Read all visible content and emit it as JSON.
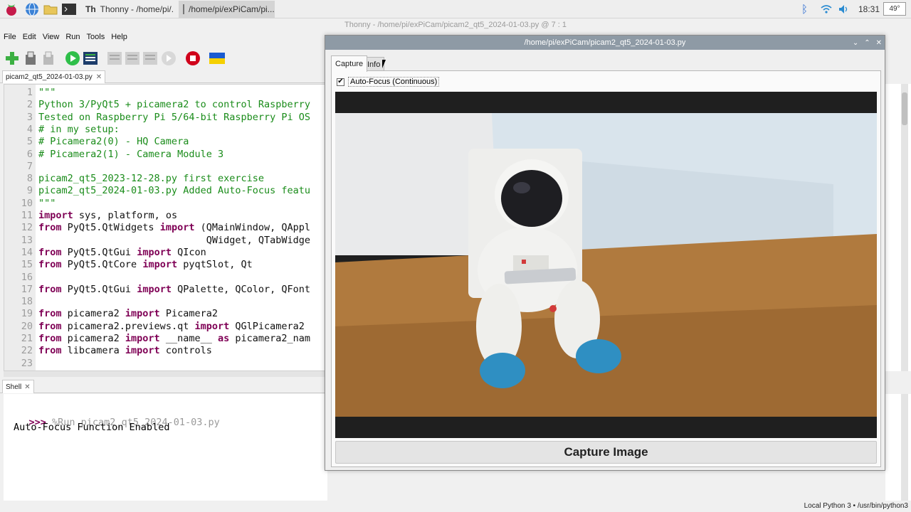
{
  "taskbar": {
    "tasks": [
      {
        "label": "Thonny  -  /home/pi/..."
      },
      {
        "label": "/home/pi/exPiCam/pi..."
      }
    ],
    "clock": "18:31",
    "cpu": "49°"
  },
  "thonny": {
    "title": "Thonny  -  /home/pi/exPiCam/picam2_qt5_2024-01-03.py  @  7 : 1",
    "menu": [
      "File",
      "Edit",
      "View",
      "Run",
      "Tools",
      "Help"
    ],
    "editor_tab": "picam2_qt5_2024-01-03.py",
    "line_numbers": [
      "1",
      "2",
      "3",
      "4",
      "5",
      "6",
      "7",
      "8",
      "9",
      "10",
      "11",
      "12",
      "13",
      "14",
      "15",
      "16",
      "17",
      "18",
      "19",
      "20",
      "21",
      "22",
      "23"
    ],
    "code_lines": [
      [
        {
          "t": "\"\"\"",
          "c": "str"
        }
      ],
      [
        {
          "t": "Python 3/PyQt5 + picamera2 to control Raspberry",
          "c": "str"
        }
      ],
      [
        {
          "t": "Tested on Raspberry Pi 5/64-bit Raspberry Pi OS",
          "c": "str"
        }
      ],
      [
        {
          "t": "# in my setup:",
          "c": "str"
        }
      ],
      [
        {
          "t": "# Picamera2(0) - HQ Camera",
          "c": "str"
        }
      ],
      [
        {
          "t": "# Picamera2(1) - Camera Module 3",
          "c": "str"
        }
      ],
      [
        {
          "t": "",
          "c": ""
        }
      ],
      [
        {
          "t": "picam2_qt5_2023-12-28.py first exercise",
          "c": "str"
        }
      ],
      [
        {
          "t": "picam2_qt5_2024-01-03.py Added Auto-Focus featu",
          "c": "str"
        }
      ],
      [
        {
          "t": "\"\"\"",
          "c": "str"
        }
      ],
      [
        {
          "t": "import",
          "c": "kw"
        },
        {
          "t": " sys, platform, os",
          "c": ""
        }
      ],
      [
        {
          "t": "from",
          "c": "kw"
        },
        {
          "t": " PyQt5.QtWidgets ",
          "c": ""
        },
        {
          "t": "import",
          "c": "kw"
        },
        {
          "t": " (QMainWindow, QAppl",
          "c": ""
        }
      ],
      [
        {
          "t": "                             QWidget, QTabWidge",
          "c": ""
        }
      ],
      [
        {
          "t": "from",
          "c": "kw"
        },
        {
          "t": " PyQt5.QtGui ",
          "c": ""
        },
        {
          "t": "import",
          "c": "kw"
        },
        {
          "t": " QIcon",
          "c": ""
        }
      ],
      [
        {
          "t": "from",
          "c": "kw"
        },
        {
          "t": " PyQt5.QtCore ",
          "c": ""
        },
        {
          "t": "import",
          "c": "kw"
        },
        {
          "t": " pyqtSlot, Qt",
          "c": ""
        }
      ],
      [
        {
          "t": "",
          "c": ""
        }
      ],
      [
        {
          "t": "from",
          "c": "kw"
        },
        {
          "t": " PyQt5.QtGui ",
          "c": ""
        },
        {
          "t": "import",
          "c": "kw"
        },
        {
          "t": " QPalette, QColor, QFont",
          "c": ""
        }
      ],
      [
        {
          "t": "",
          "c": ""
        }
      ],
      [
        {
          "t": "from",
          "c": "kw"
        },
        {
          "t": " picamera2 ",
          "c": ""
        },
        {
          "t": "import",
          "c": "kw"
        },
        {
          "t": " Picamera2",
          "c": ""
        }
      ],
      [
        {
          "t": "from",
          "c": "kw"
        },
        {
          "t": " picamera2.previews.qt ",
          "c": ""
        },
        {
          "t": "import",
          "c": "kw"
        },
        {
          "t": " QGlPicamera2",
          "c": ""
        }
      ],
      [
        {
          "t": "from",
          "c": "kw"
        },
        {
          "t": " picamera2 ",
          "c": ""
        },
        {
          "t": "import",
          "c": "kw"
        },
        {
          "t": " __name__ ",
          "c": ""
        },
        {
          "t": "as",
          "c": "kw"
        },
        {
          "t": " picamera2_nam",
          "c": ""
        }
      ],
      [
        {
          "t": "from",
          "c": "kw"
        },
        {
          "t": " libcamera ",
          "c": ""
        },
        {
          "t": "import",
          "c": "kw"
        },
        {
          "t": " controls",
          "c": ""
        }
      ],
      [
        {
          "t": "",
          "c": ""
        }
      ]
    ],
    "shell_tab": "Shell",
    "shell_prompt": ">>>",
    "shell_command": " %Run picam2_qt5_2024-01-03.py",
    "shell_output": "Auto-Focus Function Enabled",
    "status_interpreter": "Local Python 3  •  /usr/bin/python3"
  },
  "popup": {
    "title": "/home/pi/exPiCam/picam2_qt5_2024-01-03.py",
    "tabs": [
      "Capture",
      "Info"
    ],
    "active_tab": "Capture",
    "autofocus_label": "Auto-Focus (Continuous)",
    "autofocus_checked": true,
    "capture_button": "Capture Image"
  }
}
